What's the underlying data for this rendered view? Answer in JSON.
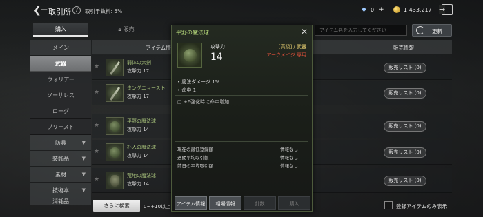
{
  "header": {
    "title": "取引所",
    "fee": "取引手数料: 5%",
    "diamonds": "0",
    "diamonds_plus": "+",
    "gold": "1,433,217"
  },
  "tabs": [
    {
      "label": "購入"
    },
    {
      "label": "販売"
    }
  ],
  "search": {
    "placeholder": "アイテム名を入力してください",
    "refresh_label": "更新"
  },
  "sidebar": {
    "items": [
      {
        "label": "メイン"
      },
      {
        "label": "武器"
      },
      {
        "label": "ウォリアー"
      },
      {
        "label": "ソーサレス"
      },
      {
        "label": "ローグ"
      },
      {
        "label": "プリースト"
      },
      {
        "label": "防具"
      },
      {
        "label": "装飾品"
      },
      {
        "label": "素材"
      },
      {
        "label": "技術本"
      },
      {
        "label": "消耗品"
      }
    ]
  },
  "table": {
    "header_name": "アイテム情報",
    "header_sales": "販売情報",
    "rows": [
      {
        "name": "弱体の大剣",
        "stat": "攻撃力 17",
        "sales": "販売リスト (0)"
      },
      {
        "name": "タングニョースト",
        "stat": "攻撃力 17",
        "sales": "販売リスト (0)"
      },
      {
        "name": "平野の魔法球",
        "stat": "攻撃力 14",
        "sales": "販売リスト (0)"
      },
      {
        "name": "朴人の魔法球",
        "stat": "攻撃力 14",
        "sales": "販売リスト (0)"
      },
      {
        "name": "荒地の魔法球",
        "stat": "攻撃力 14",
        "sales": "販売リスト (0)"
      }
    ]
  },
  "bottom": {
    "search_more": "さらに検索",
    "level_range": "0~+10以上",
    "registered_only": "登録アイテムのみ表示"
  },
  "popup": {
    "title": "平野の魔法球",
    "attack_label": "攻撃力",
    "attack_value": "14",
    "grade": "[高級] / 武器",
    "class": "アークメイジ 専用",
    "option1": "• 魔法ダメージ 1%",
    "option2": "• 命中 1",
    "enhance": "+6強化時に命中増加",
    "stats": [
      {
        "label": "現在の最低登録額",
        "value": "情報なし"
      },
      {
        "label": "週間平均取引額",
        "value": "情報なし"
      },
      {
        "label": "前日の平均取引額",
        "value": "情報なし"
      }
    ],
    "buttons": {
      "item_info": "アイテム情報",
      "market_info": "相場情報",
      "offer": "計数",
      "buy": "購入"
    }
  },
  "colors": {
    "item_name": "#a6c07a",
    "popup_title": "#b5d77a",
    "class_restriction": "#e0503a",
    "grade": "#d6c06a"
  },
  "icons": {
    "back": "back-arrow-icon",
    "help": "help-icon",
    "diamond": "diamond-icon",
    "gold": "gold-coin-icon",
    "exit": "exit-icon",
    "refresh": "refresh-icon",
    "favorite": "star-icon",
    "close": "close-icon"
  }
}
